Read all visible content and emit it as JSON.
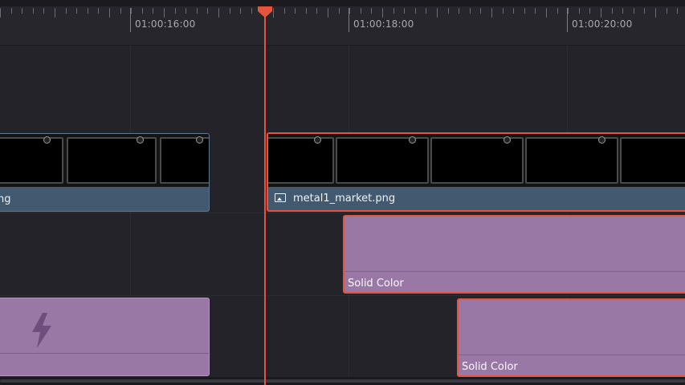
{
  "ruler": {
    "timecodes": [
      "01:00:16:00",
      "01:00:18:00",
      "01:00:20:00"
    ]
  },
  "clips": {
    "video_left": {
      "label": "ng"
    },
    "video_selected": {
      "label": "metal1_market.png",
      "icon": "image-icon"
    },
    "solid_1": {
      "label": "Solid Color"
    },
    "solid_2": {
      "label": "Solid Color"
    },
    "generator_left": {
      "icon": "lightning-bolt-icon"
    }
  },
  "colors": {
    "playhead": "#e5543d",
    "video_clip": "#42596f",
    "solid_color_clip": "#9a78a6",
    "selection": "#e5543d"
  }
}
